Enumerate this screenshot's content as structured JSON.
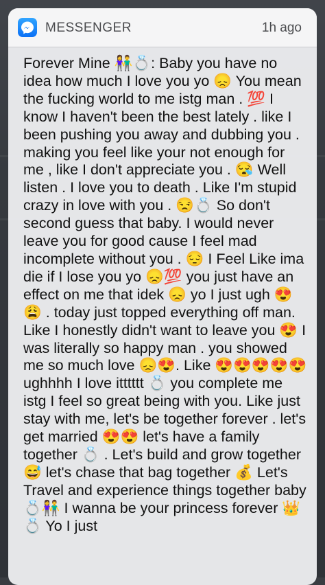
{
  "notification": {
    "app_name": "MESSENGER",
    "time": "1h ago",
    "icon": "messenger-icon",
    "accent_color": "#0a6ff5"
  },
  "message": {
    "sender": "Forever Mine 👫💍:",
    "text": "Baby you have no idea how much I love you yo 😞 You mean the fucking world to me istg man . 💯 I know I haven't been the best lately . like I been pushing you away and dubbing you . making you feel like your not enough for me , like I don't appreciate you . 😪 Well listen . I love you to death . Like I'm stupid crazy in love with you . 😒💍 So don't second guess that baby. I would never leave you for good cause I feel mad incomplete without you . 😔 I Feel Like ima die if I lose you yo 😞💯 you just have an effect on me that idek 😞 yo I just ugh 😍😩 . today just topped everything off man. Like I honestly didn't want to leave you 😍 I was literally so happy man . you showed me so much love 😞😍. Like 😍😍😍😍😍 ughhhh I love itttttt 💍 you complete me istg I feel so great being with you. Like just stay with me, let's be together forever . let's get married 😍😍 let's have a family together 💍 . Let's build and grow together 😅 let's chase that bag together 💰 Let's Travel and experience things together baby 💍👫 I wanna be your princess forever 👑💍 Yo I just"
  }
}
